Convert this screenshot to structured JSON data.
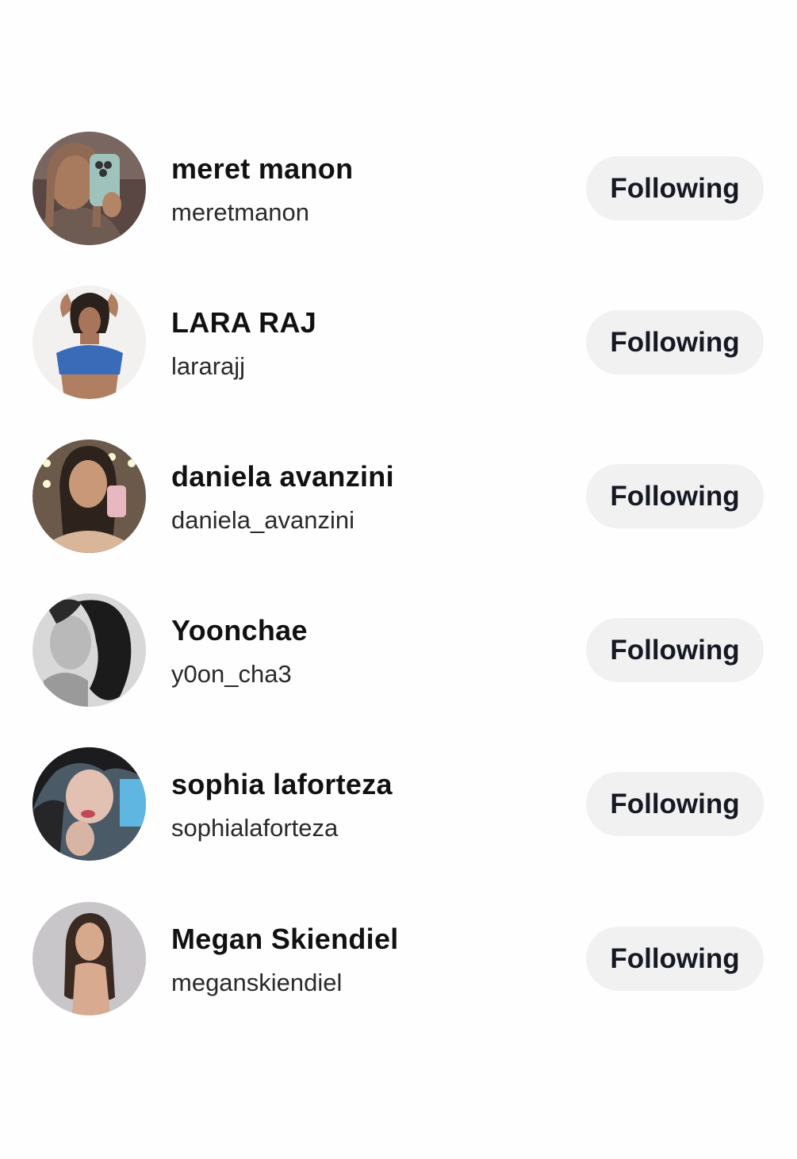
{
  "following_list": {
    "users": [
      {
        "display_name": "meret manon",
        "username": "meretmanon",
        "button_label": "Following"
      },
      {
        "display_name": "LARA RAJ",
        "username": "lararajj",
        "button_label": "Following"
      },
      {
        "display_name": "daniela avanzini",
        "username": "daniela_avanzini",
        "button_label": "Following"
      },
      {
        "display_name": "Yoonchae",
        "username": "y0on_cha3",
        "button_label": "Following"
      },
      {
        "display_name": "sophia laforteza",
        "username": "sophialaforteza",
        "button_label": "Following"
      },
      {
        "display_name": "Megan Skiendiel",
        "username": "meganskiendiel",
        "button_label": "Following"
      }
    ]
  },
  "colors": {
    "background": "#fefefe",
    "button_background": "#f1f1f2",
    "text_primary": "#111111",
    "text_secondary": "#2a2a2a"
  }
}
